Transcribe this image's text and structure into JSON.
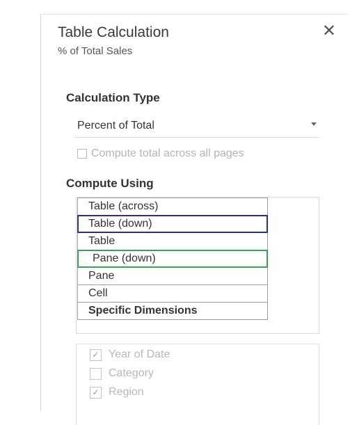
{
  "dialog": {
    "title": "Table Calculation",
    "subtitle": "% of Total Sales",
    "close_icon": "close-icon"
  },
  "calculation_type": {
    "label": "Calculation Type",
    "selected": "Percent of Total",
    "compute_total_label": "Compute total across all pages",
    "compute_total_checked": false
  },
  "compute_using": {
    "label": "Compute Using",
    "options": [
      {
        "label": "Table (across)",
        "highlight": "none"
      },
      {
        "label": "Table (down)",
        "highlight": "blue"
      },
      {
        "label": "Table",
        "highlight": "none"
      },
      {
        "label": "Pane (down)",
        "highlight": "green"
      },
      {
        "label": "Pane",
        "highlight": "none"
      },
      {
        "label": "Cell",
        "highlight": "none"
      },
      {
        "label": "Specific Dimensions",
        "highlight": "none"
      }
    ]
  },
  "dimensions": [
    {
      "label": "Year of Date",
      "checked": true
    },
    {
      "label": "Category",
      "checked": false
    },
    {
      "label": "Region",
      "checked": true
    }
  ],
  "colors": {
    "blue_highlight": "#2c2c8a",
    "green_highlight": "#3c9a5a"
  }
}
